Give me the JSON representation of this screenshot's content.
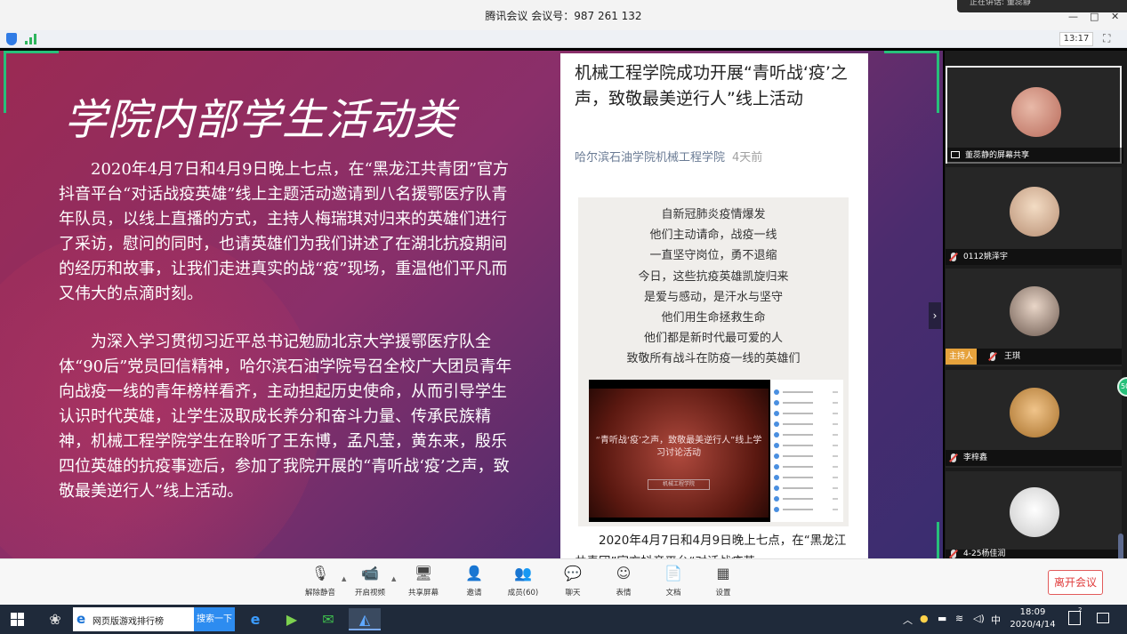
{
  "window": {
    "title": "腾讯会议 会议号：987 261 132",
    "notification": "正在讲话: 董蕊静",
    "controls": [
      "—",
      "□",
      "✕"
    ]
  },
  "strip": {
    "time": "13:17"
  },
  "slide": {
    "title": "学院内部学生活动类",
    "paragraph1": "2020年4月7日和4月9日晚上七点，在“黑龙江共青团”官方抖音平台“对话战疫英雄”线上主题活动邀请到八名援鄂医疗队青年队员，以线上直播的方式，主持人梅瑞琪对归来的英雄们进行了采访，慰问的同时，也请英雄们为我们讲述了在湖北抗疫期间的经历和故事，让我们走进真实的战“疫”现场，重温他们平凡而又伟大的点滴时刻。",
    "paragraph2": "为深入学习贯彻习近平总书记勉励北京大学援鄂医疗队全体“90后”党员回信精神，哈尔滨石油学院号召全校广大团员青年向战疫一线的青年榜样看齐，主动担起历史使命，从而引导学生认识时代英雄，让学生汲取成长养分和奋斗力量、传承民族精神，机械工程学院学生在聆听了王东博，孟凡莹，黄东来，殷乐四位英雄的抗疫事迹后，参加了我院开展的“青听战‘疫’之声，致敬最美逆行人”线上活动。"
  },
  "article": {
    "title": "机械工程学院成功开展“青听战‘疫’之声，致敬最美逆行人”线上活动",
    "source": "哈尔滨石油学院机械工程学院",
    "time_ago": "4天前",
    "poem": [
      "自新冠肺炎疫情爆发",
      "他们主动请命，战疫一线",
      "一直坚守岗位，勇不退缩",
      "今日，这些抗疫英雄凯旋归来",
      "是爱与感动，是汗水与坚守",
      "他们用生命拯救生命",
      "他们都是新时代最可爱的人",
      "致敬所有战斗在防疫一线的英雄们"
    ],
    "video_caption": "“青听战‘疫’之声，致敬最美逆行人”线上学习讨论活动",
    "video_badge": "机械工程学院",
    "body": "2020年4月7日和4月9日晚上七点，在“黑龙江共青团”官方抖音平台“对话战疫英"
  },
  "participants": [
    {
      "name": "董蕊静的屏幕共享",
      "host": false,
      "screen_share": true,
      "mic_off": false,
      "avatar_color": "#c98a7a"
    },
    {
      "name": "0112姚泽宇",
      "host": false,
      "screen_share": false,
      "mic_off": true,
      "avatar_color": "#e8c9a8"
    },
    {
      "name": "王琪",
      "host": true,
      "host_label": "主持人",
      "screen_share": false,
      "mic_off": true,
      "avatar_color": "#d9c3b4"
    },
    {
      "name": "李梓鑫",
      "host": false,
      "screen_share": false,
      "mic_off": true,
      "avatar_color": "#d9a86a"
    },
    {
      "name": "4-25杨佳润",
      "host": false,
      "screen_share": false,
      "mic_off": true,
      "avatar_color": "#e8e8e8"
    }
  ],
  "green_badge": "50",
  "toolbar": {
    "buttons": [
      {
        "label": "解除静音",
        "icon": "mic-off-icon"
      },
      {
        "label": "开启视频",
        "icon": "camera-off-icon"
      },
      {
        "label": "共享屏幕",
        "icon": "share-screen-icon"
      },
      {
        "label": "邀请",
        "icon": "invite-icon"
      },
      {
        "label": "成员(60)",
        "icon": "members-icon"
      },
      {
        "label": "聊天",
        "icon": "chat-icon"
      },
      {
        "label": "表情",
        "icon": "emoji-icon"
      },
      {
        "label": "文档",
        "icon": "document-icon"
      },
      {
        "label": "设置",
        "icon": "settings-icon"
      }
    ],
    "leave": "离开会议"
  },
  "taskbar": {
    "search_text": "网页版游戏排行榜",
    "search_button": "搜索一下",
    "ime": "中",
    "clock_time": "18:09",
    "clock_date": "2020/4/14",
    "notification_count": "2"
  },
  "colors": {
    "accent_green": "#27c07a",
    "leave_red": "#e03c3c",
    "host_orange": "#e6a23c"
  }
}
